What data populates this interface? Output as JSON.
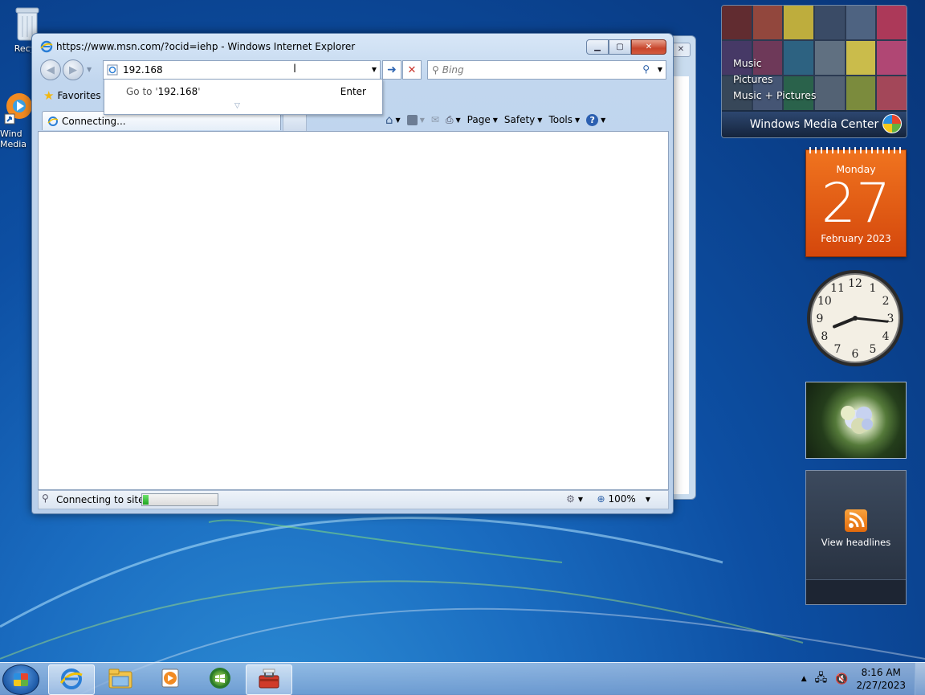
{
  "desktop": {
    "icons": [
      {
        "label": "Recyc",
        "icon": "recycle-bin-icon"
      },
      {
        "label": "Wind Media",
        "icon": "media-player-shortcut-icon"
      }
    ]
  },
  "ie": {
    "title": "https://www.msn.com/?ocid=iehp - Windows Internet Explorer",
    "address_value": "192.168",
    "search_placeholder": "Bing",
    "autocomplete": {
      "prefix": "Go to '",
      "value": "192.168",
      "suffix": "'",
      "action": "Enter"
    },
    "favorites_label": "Favorites",
    "tab_label": "Connecting...",
    "command_bar": {
      "page": "Page",
      "safety": "Safety",
      "tools": "Tools"
    },
    "status": {
      "text": "Connecting to site",
      "progress": 0.08,
      "zoom": "100%"
    }
  },
  "gadgets": {
    "media_center": {
      "menu": [
        "Music",
        "Pictures",
        "Music + Pictures"
      ],
      "title": "Windows Media Center"
    },
    "calendar": {
      "weekday": "Monday",
      "day": "27",
      "month_year": "February 2023"
    },
    "clock": {
      "numerals": [
        "12",
        "1",
        "2",
        "3",
        "4",
        "5",
        "6",
        "7",
        "8",
        "9",
        "10",
        "11"
      ],
      "time_shown": "8:16"
    },
    "feeds": {
      "label": "View headlines"
    }
  },
  "taskbar": {
    "time": "8:16 AM",
    "date": "2/27/2023",
    "buttons": [
      "internet-explorer-icon",
      "windows-explorer-icon",
      "media-player-icon",
      "media-center-icon",
      "toolbox-icon"
    ]
  },
  "colors": {
    "desktop_blue": "#0d4fa3",
    "calendar_orange": "#e0580f",
    "progress_green": "#1fa51f"
  }
}
